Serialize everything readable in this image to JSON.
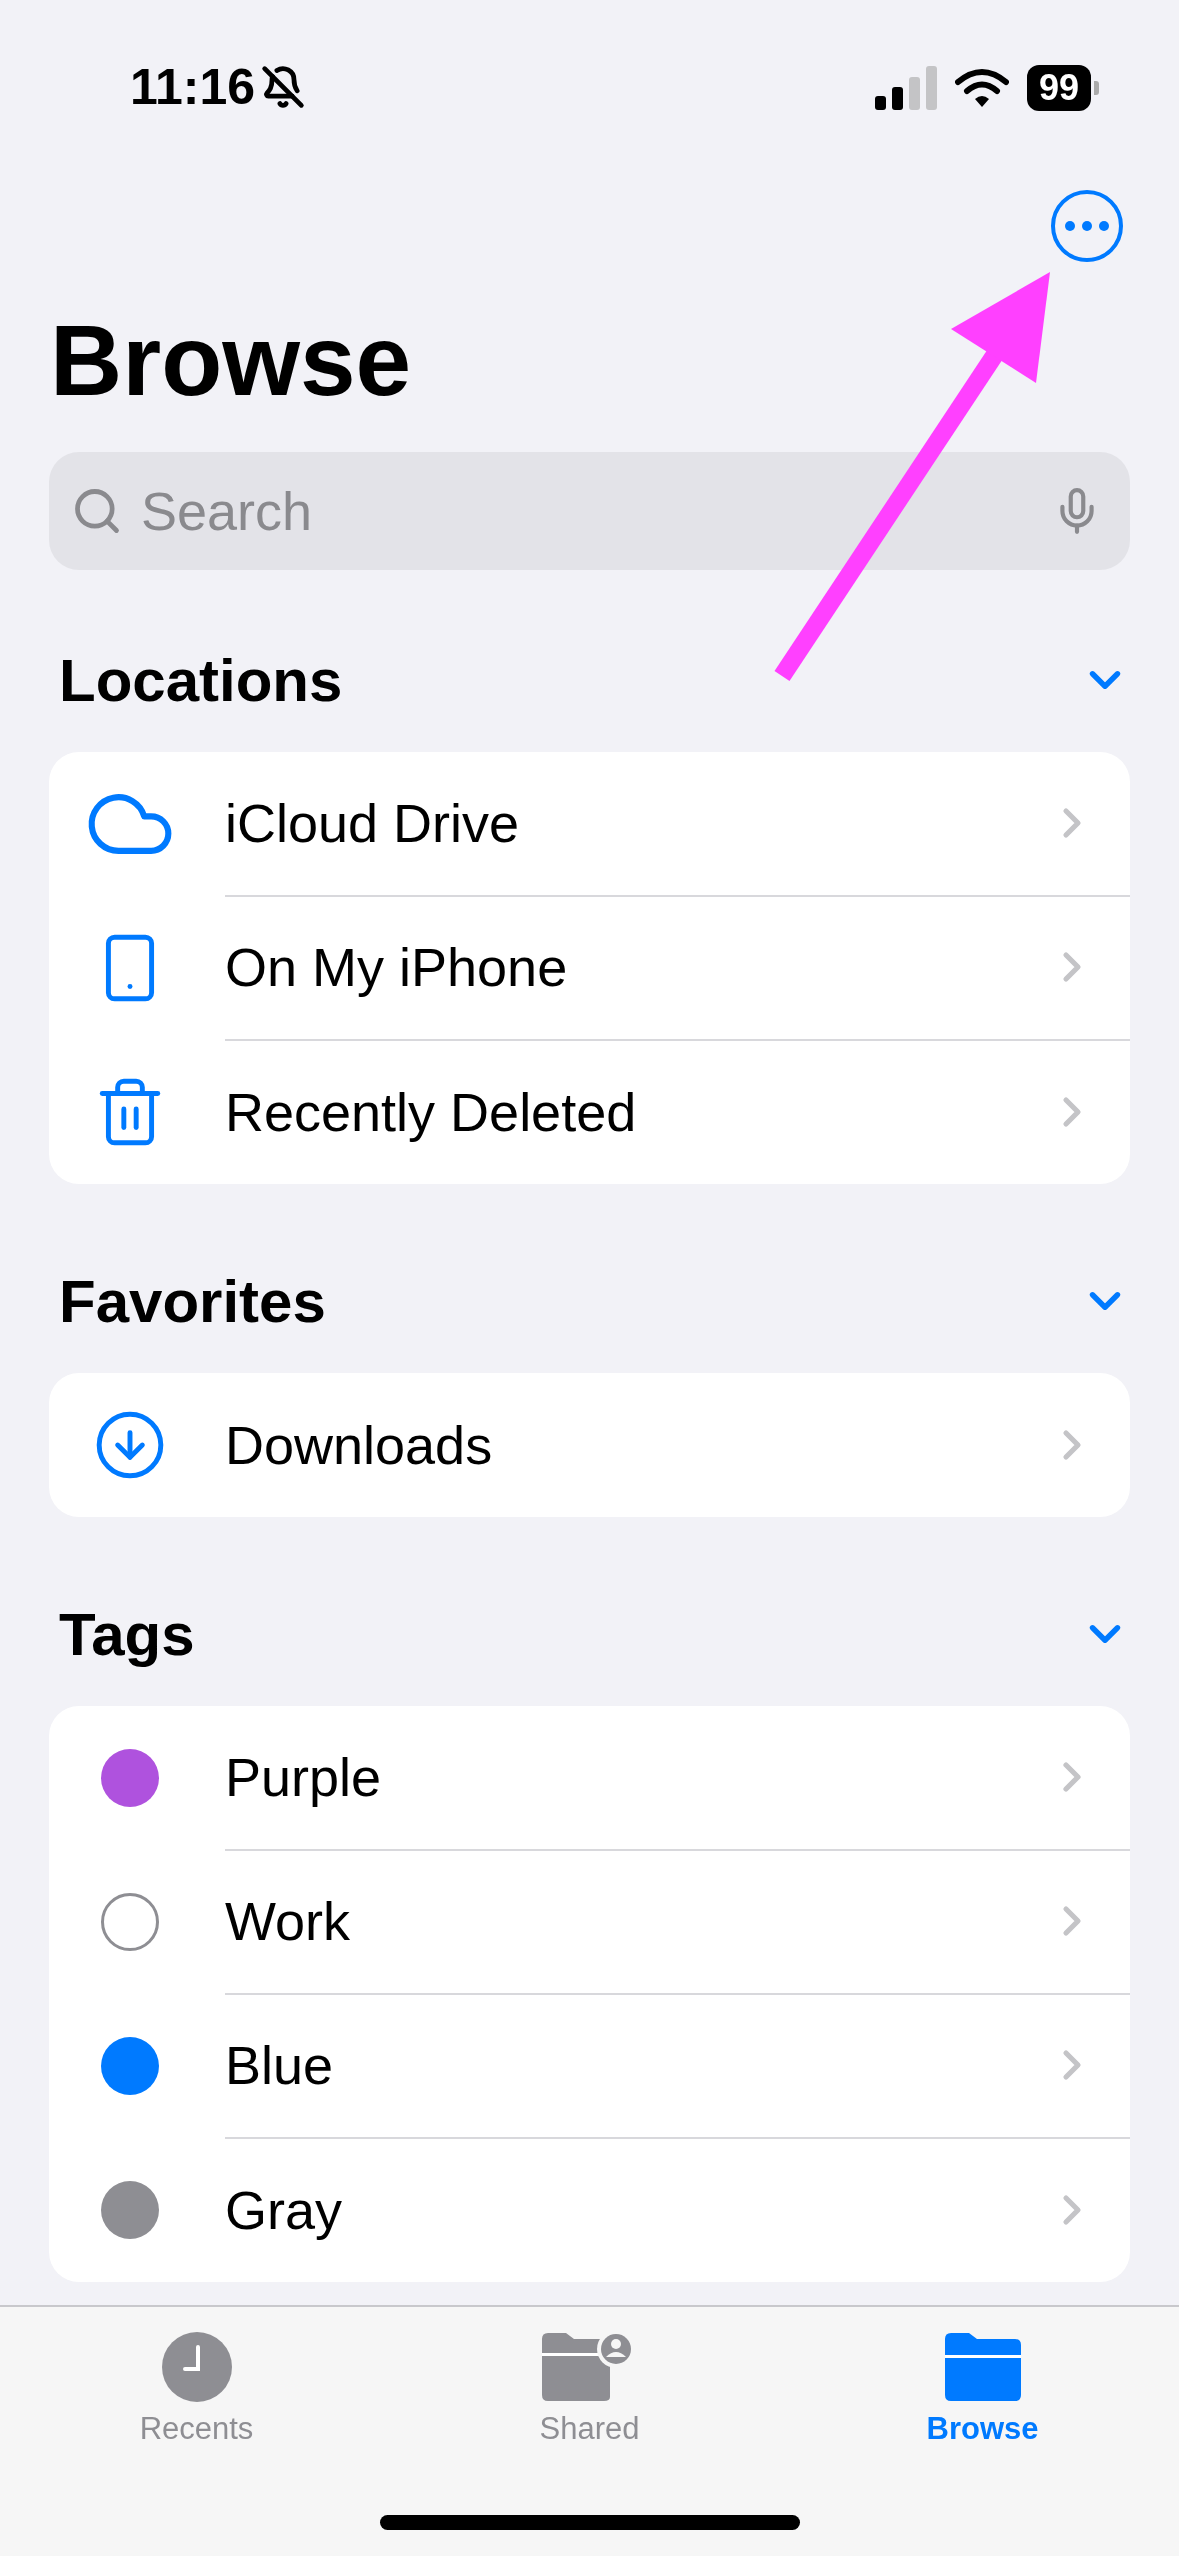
{
  "status_bar": {
    "time": "11:16",
    "silent": true,
    "battery": "99"
  },
  "title": "Browse",
  "search": {
    "placeholder": "Search"
  },
  "sections": [
    {
      "title": "Locations",
      "expanded": true,
      "items": [
        {
          "label": "iCloud Drive",
          "kind": "cloud"
        },
        {
          "label": "On My iPhone",
          "kind": "phone"
        },
        {
          "label": "Recently Deleted",
          "kind": "trash"
        }
      ]
    },
    {
      "title": "Favorites",
      "expanded": true,
      "items": [
        {
          "label": "Downloads",
          "kind": "download"
        }
      ]
    },
    {
      "title": "Tags",
      "expanded": true,
      "items": [
        {
          "label": "Purple",
          "kind": "tag",
          "color": "#af52de"
        },
        {
          "label": "Work",
          "kind": "tag"
        },
        {
          "label": "Blue",
          "kind": "tag",
          "color": "#007aff"
        },
        {
          "label": "Gray",
          "kind": "tag",
          "color": "#8e8e93"
        }
      ]
    }
  ],
  "tabs": [
    {
      "label": "Recents",
      "kind": "recents",
      "selected": false
    },
    {
      "label": "Shared",
      "kind": "shared",
      "selected": false
    },
    {
      "label": "Browse",
      "kind": "browse",
      "selected": true
    }
  ],
  "annotation": {
    "kind": "arrow"
  }
}
